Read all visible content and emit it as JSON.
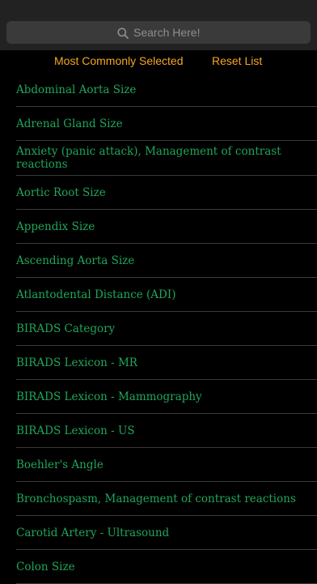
{
  "search": {
    "placeholder": "Search Here!"
  },
  "actions": {
    "most_common_label": "Most Commonly Selected",
    "reset_label": "Reset List"
  },
  "colors": {
    "background": "#000000",
    "search_bar_bg": "#222222",
    "search_field_bg": "#3a3a3a",
    "accent_orange": "#f5a623",
    "item_text_green": "#1fa65a",
    "divider": "#3a3a3a"
  },
  "items": [
    {
      "label": "Abdominal Aorta Size"
    },
    {
      "label": "Adrenal Gland Size"
    },
    {
      "label": "Anxiety (panic attack), Management of contrast reactions"
    },
    {
      "label": "Aortic Root Size"
    },
    {
      "label": "Appendix Size"
    },
    {
      "label": "Ascending Aorta Size"
    },
    {
      "label": "Atlantodental Distance (ADI)"
    },
    {
      "label": "BIRADS Category"
    },
    {
      "label": "BIRADS Lexicon - MR"
    },
    {
      "label": "BIRADS Lexicon - Mammography"
    },
    {
      "label": "BIRADS Lexicon - US"
    },
    {
      "label": "Boehler's Angle"
    },
    {
      "label": "Bronchospasm, Management of contrast reactions"
    },
    {
      "label": "Carotid Artery - Ultrasound"
    },
    {
      "label": "Colon Size"
    }
  ]
}
